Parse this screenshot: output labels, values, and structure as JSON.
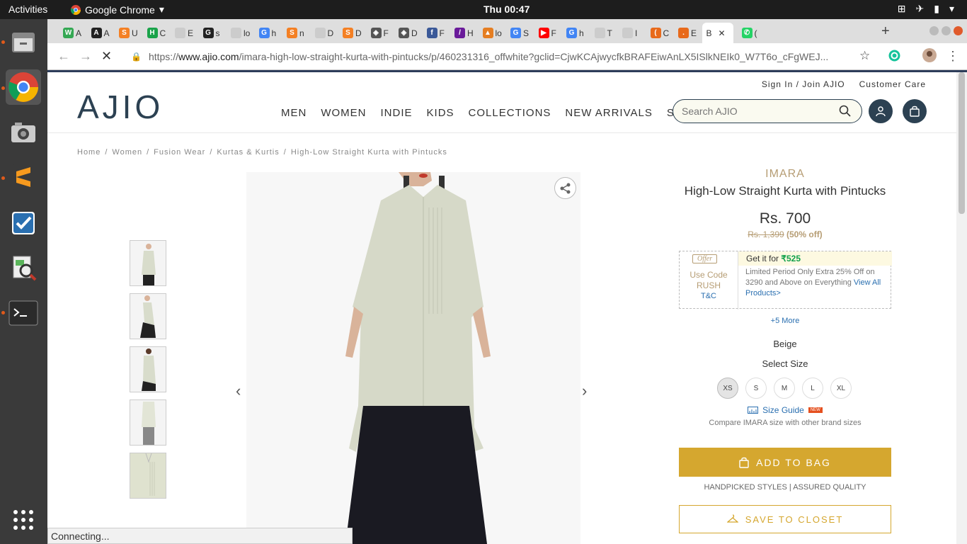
{
  "system": {
    "activities": "Activities",
    "app_name": "Google Chrome",
    "clock": "Thu 00:47"
  },
  "tabs": [
    {
      "label": "A",
      "fav_color": "#34a853",
      "fav_text": "W"
    },
    {
      "label": "A",
      "fav_color": "#222222",
      "fav_text": "A"
    },
    {
      "label": "U",
      "fav_color": "#f48024",
      "fav_text": "S"
    },
    {
      "label": "C",
      "fav_color": "#1aa34a",
      "fav_text": "H"
    },
    {
      "label": "E",
      "fav_color": "#cccccc",
      "fav_text": ""
    },
    {
      "label": "s",
      "fav_color": "#222222",
      "fav_text": "G"
    },
    {
      "label": "lo",
      "fav_color": "#cccccc",
      "fav_text": ""
    },
    {
      "label": "h",
      "fav_color": "#4285f4",
      "fav_text": "G"
    },
    {
      "label": "n",
      "fav_color": "#f48024",
      "fav_text": "S"
    },
    {
      "label": "D",
      "fav_color": "#cccccc",
      "fav_text": ""
    },
    {
      "label": "D",
      "fav_color": "#f48024",
      "fav_text": "S"
    },
    {
      "label": "F",
      "fav_color": "#555555",
      "fav_text": "◈"
    },
    {
      "label": "D",
      "fav_color": "#555555",
      "fav_text": "◈"
    },
    {
      "label": "F",
      "fav_color": "#3b5998",
      "fav_text": "f"
    },
    {
      "label": "H",
      "fav_color": "#6a1b9a",
      "fav_text": "/"
    },
    {
      "label": "lo",
      "fav_color": "#e57e22",
      "fav_text": "▲"
    },
    {
      "label": "S",
      "fav_color": "#4285f4",
      "fav_text": "G"
    },
    {
      "label": "F",
      "fav_color": "#ff0000",
      "fav_text": "▶"
    },
    {
      "label": "h",
      "fav_color": "#4285f4",
      "fav_text": "G"
    },
    {
      "label": "T",
      "fav_color": "#cccccc",
      "fav_text": ""
    },
    {
      "label": "I",
      "fav_color": "#cccccc",
      "fav_text": ""
    },
    {
      "label": "C",
      "fav_color": "#e86a1b",
      "fav_text": "("
    },
    {
      "label": "E",
      "fav_color": "#e86a1b",
      "fav_text": "."
    },
    {
      "label": "B",
      "fav_color": "#ffffff",
      "fav_text": "",
      "active": true
    },
    {
      "label": "(",
      "fav_color": "#25d366",
      "fav_text": "✆"
    }
  ],
  "omnibox": {
    "protocol": "https://",
    "domain": "www.ajio.com",
    "path": "/imara-high-low-straight-kurta-with-pintucks/p/460231316_offwhite?gclid=CjwKCAjwycfkBRAFEiwAnLX5ISlkNEIk0_W7T6o_cFgWEJ..."
  },
  "site": {
    "logo": "AJIO",
    "signin": "Sign In / Join AJIO",
    "customer_care": "Customer Care",
    "nav": [
      "MEN",
      "WOMEN",
      "INDIE",
      "KIDS",
      "COLLECTIONS",
      "NEW ARRIVALS",
      "SALE"
    ],
    "search_placeholder": "Search AJIO"
  },
  "breadcrumb": [
    "Home",
    "/",
    "Women",
    "/",
    "Fusion Wear",
    "/",
    "Kurtas & Kurtis",
    "/",
    "High-Low Straight Kurta with Pintucks"
  ],
  "product": {
    "brand": "IMARA",
    "name": "High-Low Straight Kurta with Pintucks",
    "price": "Rs. 700",
    "mrp": "Rs. 1,399",
    "discount": "(50% off)",
    "offer": {
      "tag": "Offer",
      "use_code": "Use Code",
      "code": "RUSH",
      "tc": "T&C",
      "get_it_for": "Get it for",
      "offer_price": "₹525",
      "desc": "Limited Period Only Extra 25% Off on 3290 and Above on Everything",
      "view_all": "View All Products>"
    },
    "more_offers": "+5 More",
    "color": "Beige",
    "select_size": "Select Size",
    "sizes": [
      "XS",
      "S",
      "M",
      "L",
      "XL"
    ],
    "selected_size": "XS",
    "size_guide": "Size Guide",
    "new_badge": "NEW",
    "compare": "Compare IMARA size with other brand sizes",
    "add_to_bag": "ADD TO BAG",
    "handpicked": "HANDPICKED STYLES | ASSURED QUALITY",
    "save_to_closet": "SAVE TO CLOSET"
  },
  "status_bar": "Connecting..."
}
